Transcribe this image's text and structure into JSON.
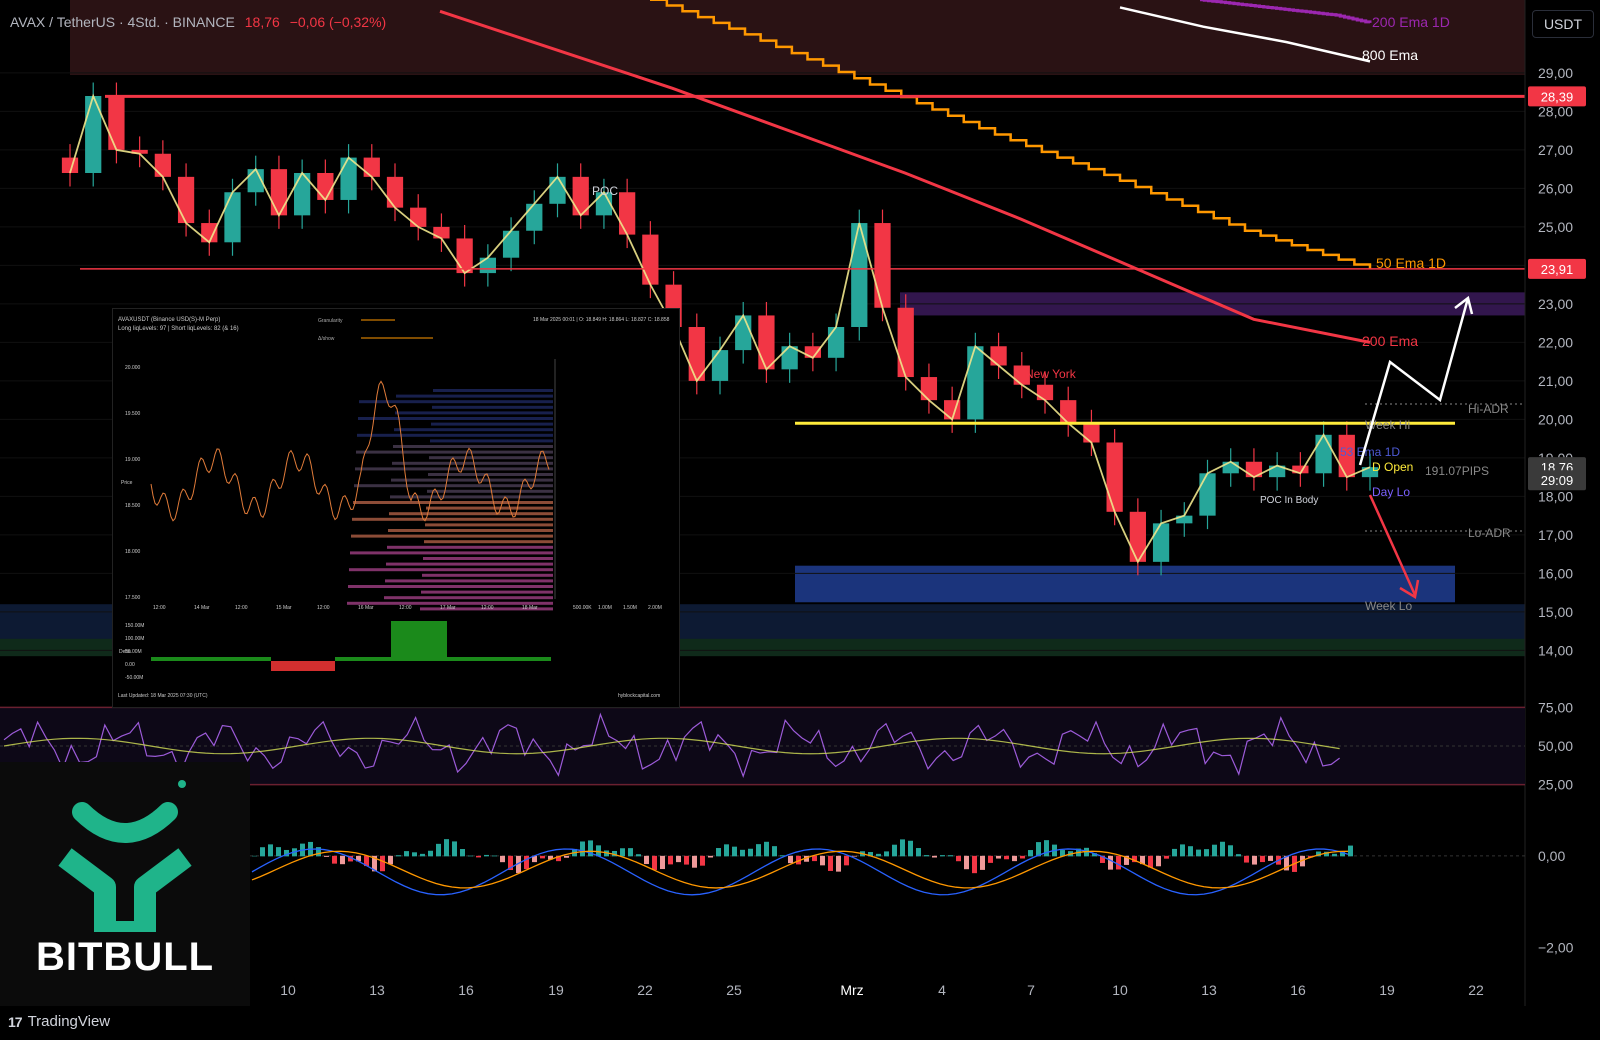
{
  "header": {
    "symbol": "AVAX / TetherUS · 4Std. · BINANCE",
    "price": "18,76",
    "change": "−0,06 (−0,32%)"
  },
  "currency_button": "USDT",
  "branding": {
    "logo_text": "BITBULL",
    "platform": "TradingView"
  },
  "colors": {
    "up": "#26a69a",
    "down": "#f23645",
    "ema200": "#f23645",
    "ema50_1d": "#ff9800",
    "ema200_1d": "#9c27b0",
    "ema800": "#ffffff",
    "yellow": "#ffeb3b",
    "blue_zone": "#1e3a8a"
  },
  "chart_data": {
    "type": "line",
    "x_ticks": [
      "10",
      "13",
      "16",
      "19",
      "22",
      "25",
      "Mrz",
      "4",
      "7",
      "10",
      "13",
      "16",
      "19",
      "22"
    ],
    "y_ticks": [
      "29,00",
      "28,00",
      "27,00",
      "26,00",
      "25,00",
      "24,00",
      "23,00",
      "22,00",
      "21,00",
      "20,00",
      "19,00",
      "18,00",
      "17,00",
      "16,00",
      "15,00",
      "14,00"
    ],
    "ylim": [
      13.6,
      30.4
    ],
    "price_labels": [
      {
        "text": "28,39",
        "value": 28.39,
        "color": "#f23645"
      },
      {
        "text": "23,91",
        "value": 23.91,
        "color": "#f23645"
      },
      {
        "text": "18,76",
        "value": 18.76,
        "color": "#3a3a3a"
      },
      {
        "text": "29:09",
        "value": 18.42,
        "color": "#3a3a3a"
      }
    ],
    "series": [
      {
        "name": "200 Ema 1D",
        "values": [
          30.9,
          30.8,
          30.7,
          30.6,
          30.5,
          30.3
        ]
      },
      {
        "name": "800 Ema",
        "values": [
          30.7,
          30.2,
          29.8,
          29.3
        ]
      },
      {
        "name": "50 Ema 1D",
        "values": [
          31.2,
          30.0,
          28.7,
          27.4,
          26.2,
          24.9,
          23.9
        ]
      },
      {
        "name": "200 Ema",
        "values": [
          30.6,
          29.6,
          28.6,
          27.5,
          26.4,
          25.2,
          23.9,
          22.6,
          22.0
        ]
      }
    ],
    "close": [
      26.4,
      28.4,
      27.0,
      26.9,
      26.3,
      25.1,
      24.6,
      25.9,
      26.5,
      25.3,
      26.4,
      25.7,
      26.8,
      26.3,
      25.5,
      25.0,
      24.7,
      23.8,
      24.2,
      24.9,
      25.6,
      26.3,
      25.3,
      25.9,
      24.8,
      23.5,
      22.4,
      21.0,
      21.8,
      22.7,
      21.3,
      21.9,
      21.6,
      22.4,
      25.1,
      22.9,
      21.1,
      20.5,
      20.0,
      21.9,
      21.4,
      20.9,
      20.5,
      19.9,
      19.4,
      17.6,
      16.3,
      17.3,
      17.5,
      18.6,
      18.9,
      18.5,
      18.8,
      18.6,
      19.6,
      18.5,
      18.76
    ],
    "levels": [
      {
        "name": "28,39 level",
        "value": 28.39
      },
      {
        "name": "23,91 level",
        "value": 23.91
      },
      {
        "name": "yellow level",
        "value": 19.9
      }
    ],
    "annotations": [
      "POC",
      "New York",
      "POC In Body",
      "Hi-ADR",
      "Lo-ADR",
      "Week Hi",
      "Week Lo",
      "Day Lo",
      "D Open",
      "200 Ema",
      "50 Ema 1D",
      "200 Ema 1D",
      "800 Ema",
      "53 Ema 1D",
      "191.07PIPS"
    ],
    "rsi": {
      "ticks": [
        "75,00",
        "50,00",
        "25,00"
      ],
      "ylim": [
        15,
        85
      ]
    },
    "macd": {
      "ticks": [
        "0,00",
        "−2,00"
      ],
      "ylim": [
        -2.6,
        1.0
      ]
    },
    "inset_chart": {
      "title": "AVAXUSDT (Binance USD(S)-M Perp)",
      "subtitle": "Long liqLevels: 97 | Short liqLevels: 82 (& 16)",
      "controls": [
        "Granularity",
        "Δ/show"
      ],
      "ohlc": "18 Mar 2025 00:01 | O: 18.849 H: 18.864 L: 18.827 C: 18.858",
      "y_ticks": [
        "20.000",
        "19.500",
        "19.000",
        "18.500",
        "18.000",
        "17.500"
      ],
      "ylabel": "Price",
      "x_ticks": [
        "12:00",
        "14 Mar",
        "12:00",
        "15 Mar",
        "12:00",
        "16 Mar",
        "12:00",
        "17 Mar",
        "12:00",
        "18 Mar"
      ],
      "volume_ticks": [
        "500.00K",
        "1.00M",
        "1.50M",
        "2.00M"
      ],
      "delta_ticks": [
        "150.00M",
        "100.00M",
        "50.00M",
        "0.00",
        "-50.00M"
      ],
      "delta_label": "Delta",
      "footer_left": "Last Updated: 18 Mar 2025 07:30 (UTC)",
      "footer_right": "hyblockcapital.com"
    }
  }
}
